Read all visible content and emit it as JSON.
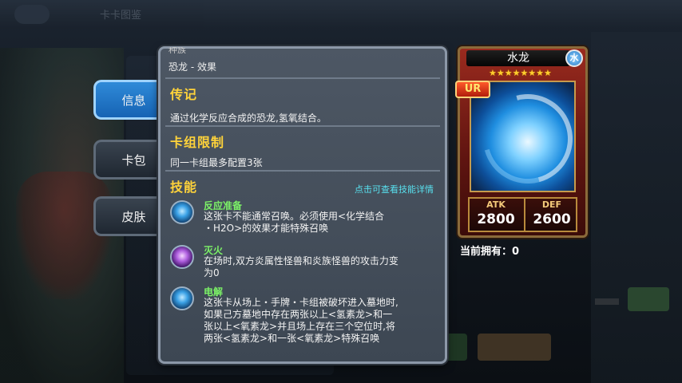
{
  "background": {
    "title": "卡卡图鉴"
  },
  "tabs": [
    {
      "label": "信息",
      "active": true
    },
    {
      "label": "卡包",
      "active": false
    },
    {
      "label": "皮肤",
      "active": false
    }
  ],
  "info": {
    "type_top_clipped": "种族",
    "type_line": "恐龙 - 效果",
    "lore": {
      "title": "传记",
      "text": "通过化学反应合成的恐龙,氢氧结合。"
    },
    "deck_limit": {
      "title": "卡组限制",
      "text": "同一卡组最多配置3张"
    },
    "skills": {
      "title": "技能",
      "hint": "点击可查看技能详情",
      "items": [
        {
          "icon": "blue-orb-icon",
          "name": "反应准备",
          "desc_lines": [
            "这张卡不能通常召唤。必须使用<化学结合",
            "・H2O>的效果才能特殊召唤"
          ]
        },
        {
          "icon": "purple-flame-icon",
          "name": "灭火",
          "desc_lines": [
            "在场时,双方炎属性怪兽和炎族怪兽的攻击力变",
            "为0"
          ]
        },
        {
          "icon": "blue-orb-icon",
          "name": "电解",
          "desc_lines": [
            "这张卡从场上・手牌・卡组被破坏进入墓地时,",
            "如果己方墓地中存在两张以上<氢素龙>和一",
            "张以上<氧素龙>并且场上存在三个空位时,将",
            "两张<氢素龙>和一张<氧素龙>特殊召唤"
          ]
        }
      ]
    }
  },
  "card": {
    "name": "水龙",
    "attribute": "水",
    "stars": "★★★★★★★★",
    "star_count": 8,
    "rarity": "UR",
    "atk_label": "ATK",
    "atk": "2800",
    "def_label": "DEF",
    "def": "2600"
  },
  "owned": "当前拥有：0",
  "colors": {
    "section_title": "#ffd33a",
    "skill_name": "#7cf267",
    "hint": "#58e0ee",
    "active_tab": "#2f8ad8"
  }
}
